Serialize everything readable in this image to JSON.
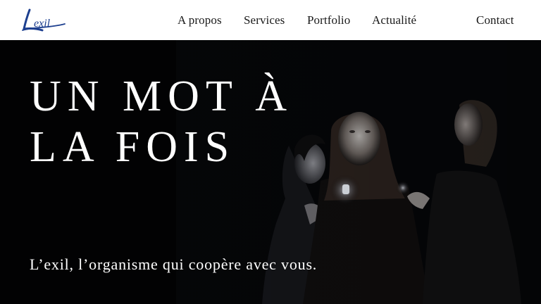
{
  "header": {
    "logo_text": "L'exil",
    "nav": [
      {
        "label": "A propos"
      },
      {
        "label": "Services"
      },
      {
        "label": "Portfolio"
      },
      {
        "label": "Actualité"
      },
      {
        "label": "Contact"
      }
    ]
  },
  "hero": {
    "title_line1": "UN MOT À",
    "title_line2": "LA FOIS",
    "subtitle": "L’exil, l’organisme qui coopère avec vous."
  },
  "colors": {
    "header_bg": "#ffffff",
    "hero_bg": "#000000",
    "logo_blue": "#1d3f8f",
    "text_light": "#ffffff"
  }
}
